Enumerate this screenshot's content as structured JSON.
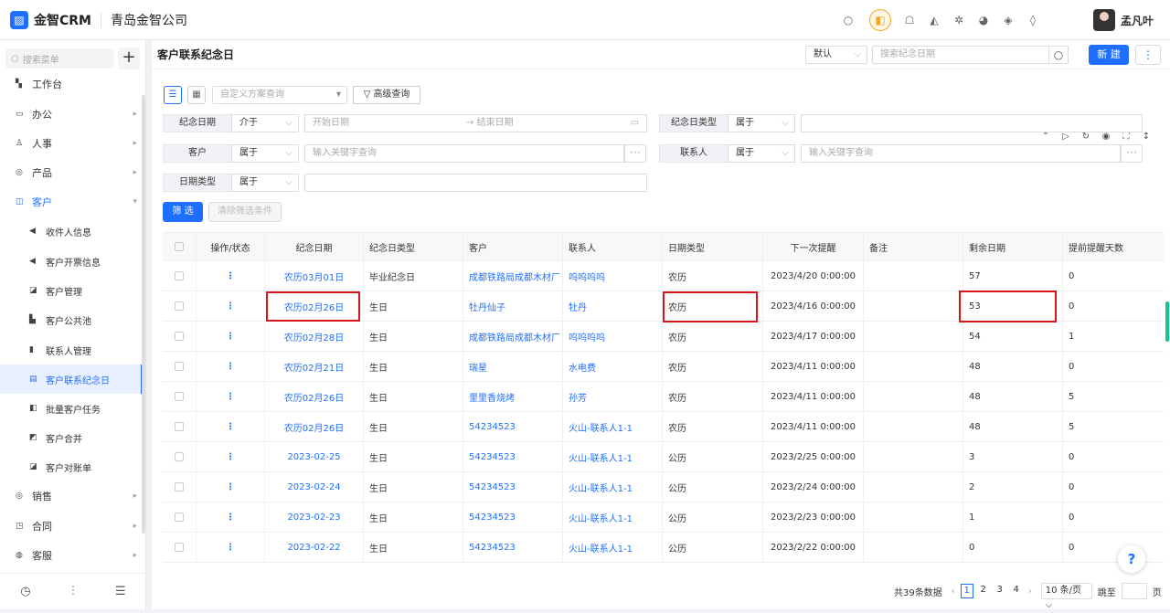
{
  "app": {
    "logo": "CRM",
    "brand": "金智CRM",
    "company": "青岛金智公司",
    "user": "孟凡叶"
  },
  "top_icons": [
    "search-icon",
    "app-highlight-icon",
    "contacts-icon",
    "bell-icon",
    "gear-icon",
    "pie-chart-icon",
    "shield-icon",
    "diamond-icon"
  ],
  "sidebar": {
    "search_placeholder": "搜索菜单",
    "plus": "+",
    "items": [
      {
        "label": "工作台",
        "icon": "▚"
      },
      {
        "label": "办公",
        "icon": "▭"
      },
      {
        "label": "人事",
        "icon": "♙"
      },
      {
        "label": "产品",
        "icon": "◎"
      },
      {
        "label": "客户",
        "icon": "◫"
      },
      {
        "label": "收件人信息",
        "icon": "◀"
      },
      {
        "label": "客户开票信息",
        "icon": "◀"
      },
      {
        "label": "客户管理",
        "icon": "◪"
      },
      {
        "label": "客户公共池",
        "icon": "▙"
      },
      {
        "label": "联系人管理",
        "icon": "▮"
      },
      {
        "label": "客户联系纪念日",
        "icon": "▤"
      },
      {
        "label": "批量客户任务",
        "icon": "◧"
      },
      {
        "label": "客户合并",
        "icon": "◩"
      },
      {
        "label": "客户对账单",
        "icon": "◪"
      },
      {
        "label": "销售",
        "icon": "◎"
      },
      {
        "label": "合同",
        "icon": "◳"
      },
      {
        "label": "客服",
        "icon": "◍"
      }
    ],
    "footer": [
      "◷",
      "⫶",
      "☰"
    ]
  },
  "header": {
    "title": "客户联系纪念日",
    "view_select": "默认",
    "search_placeholder": "搜索纪念日期",
    "new_label": "新 建",
    "more": "⋮"
  },
  "filters": {
    "scheme_placeholder": "自定义方案查询",
    "advanced": "高级查询",
    "rows": [
      {
        "label": "纪念日期",
        "op": "介于",
        "start": "开始日期",
        "end": "结束日期"
      },
      {
        "label": "纪念日类型",
        "op": "属于"
      },
      {
        "label": "客户",
        "op": "属于",
        "placeholder": "输入关键字查询"
      },
      {
        "label": "联系人",
        "op": "属于",
        "placeholder": "输入关键字查询"
      },
      {
        "label": "日期类型",
        "op": "属于"
      }
    ],
    "filter_btn": "筛 选",
    "clear_btn": "清除筛选条件",
    "dots": "···",
    "arrow": "→"
  },
  "table": {
    "headers": [
      "操作/状态",
      "纪念日期",
      "纪念日类型",
      "客户",
      "联系人",
      "日期类型",
      "下一次提醒",
      "备注",
      "剩余日期",
      "提前提醒天数"
    ],
    "rows": [
      {
        "date": "农历03月01日",
        "type": "毕业纪念日",
        "customer": "成都铁路局成都木材厂",
        "contact": "呜呜呜呜",
        "dtype": "农历",
        "next": "2023/4/20 0:00:00",
        "note": "",
        "remain": "57",
        "advance": "0"
      },
      {
        "date": "农历02月26日",
        "type": "生日",
        "customer": "牡丹仙子",
        "contact": "牡丹",
        "dtype": "农历",
        "next": "2023/4/16 0:00:00",
        "note": "",
        "remain": "53",
        "advance": "0"
      },
      {
        "date": "农历02月28日",
        "type": "生日",
        "customer": "成都铁路局成都木材厂",
        "contact": "呜呜呜呜",
        "dtype": "农历",
        "next": "2023/4/17 0:00:00",
        "note": "",
        "remain": "54",
        "advance": "1"
      },
      {
        "date": "农历02月21日",
        "type": "生日",
        "customer": "瑞星",
        "contact": "水电费",
        "dtype": "农历",
        "next": "2023/4/11 0:00:00",
        "note": "",
        "remain": "48",
        "advance": "0"
      },
      {
        "date": "农历02月26日",
        "type": "生日",
        "customer": "里里香烧烤",
        "contact": "孙芳",
        "dtype": "农历",
        "next": "2023/4/11 0:00:00",
        "note": "",
        "remain": "48",
        "advance": "5"
      },
      {
        "date": "农历02月26日",
        "type": "生日",
        "customer": "54234523",
        "contact": "火山-联系人1-1",
        "dtype": "农历",
        "next": "2023/4/11 0:00:00",
        "note": "",
        "remain": "48",
        "advance": "5"
      },
      {
        "date": "2023-02-25",
        "type": "生日",
        "customer": "54234523",
        "contact": "火山-联系人1-1",
        "dtype": "公历",
        "next": "2023/2/25 0:00:00",
        "note": "",
        "remain": "3",
        "advance": "0"
      },
      {
        "date": "2023-02-24",
        "type": "生日",
        "customer": "54234523",
        "contact": "火山-联系人1-1",
        "dtype": "公历",
        "next": "2023/2/24 0:00:00",
        "note": "",
        "remain": "2",
        "advance": "0"
      },
      {
        "date": "2023-02-23",
        "type": "生日",
        "customer": "54234523",
        "contact": "火山-联系人1-1",
        "dtype": "公历",
        "next": "2023/2/23 0:00:00",
        "note": "",
        "remain": "1",
        "advance": "0"
      },
      {
        "date": "2023-02-22",
        "type": "生日",
        "customer": "54234523",
        "contact": "火山-联系人1-1",
        "dtype": "公历",
        "next": "2023/2/22 0:00:00",
        "note": "",
        "remain": "0",
        "advance": "0"
      }
    ]
  },
  "pager": {
    "total": "共39条数据",
    "pages": [
      "1",
      "2",
      "3",
      "4"
    ],
    "size": "10 条/页",
    "jump": "跳至",
    "page_unit": "页"
  },
  "help": "?",
  "colors": {
    "accent": "#1e6fff",
    "highlight_box": "#d9141b"
  }
}
